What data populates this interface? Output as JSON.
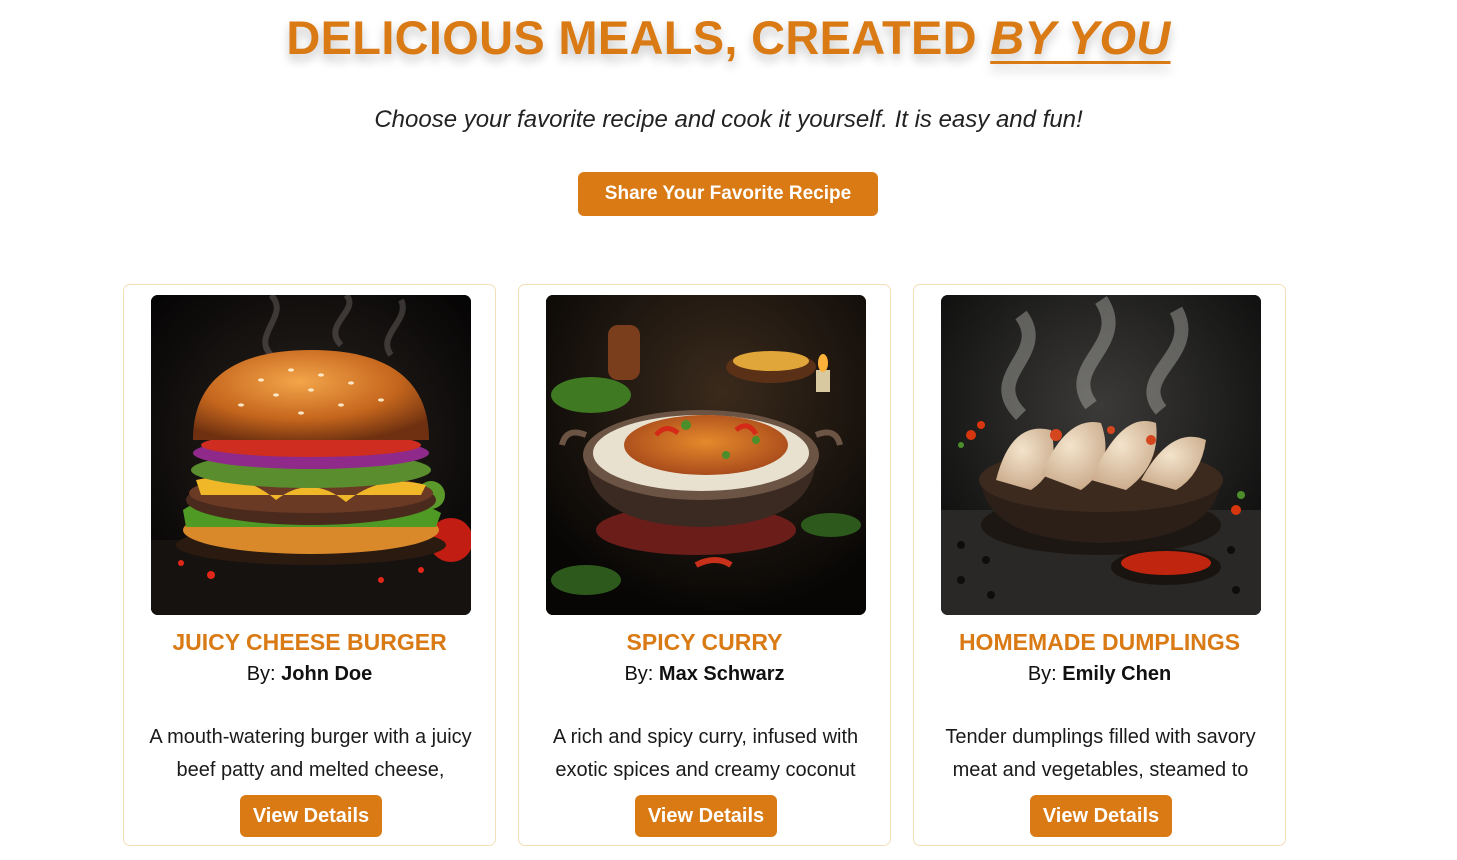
{
  "hero": {
    "title_main": "DELICIOUS MEALS, CREATED ",
    "title_accent": "BY YOU",
    "subtitle": "Choose your favorite recipe and cook it yourself. It is easy and fun!",
    "share_button_label": "Share Your Favorite Recipe"
  },
  "colors": {
    "accent": "#d97a14",
    "card_border": "#f3dfb8"
  },
  "recipes": [
    {
      "image_alt": "cheeseburger photo",
      "title": "JUICY CHEESE BURGER",
      "by_label": "By: ",
      "author": "John Doe",
      "description": "A mouth-watering burger with a juicy beef patty and melted cheese,",
      "button_label": "View Details"
    },
    {
      "image_alt": "curry photo",
      "title": "SPICY CURRY",
      "by_label": "By: ",
      "author": "Max Schwarz",
      "description": "A rich and spicy curry, infused with exotic spices and creamy coconut",
      "button_label": "View Details"
    },
    {
      "image_alt": "dumplings photo",
      "title": "HOMEMADE DUMPLINGS",
      "by_label": "By: ",
      "author": "Emily Chen",
      "description": "Tender dumplings filled with savory meat and vegetables, steamed to",
      "button_label": "View Details"
    }
  ]
}
